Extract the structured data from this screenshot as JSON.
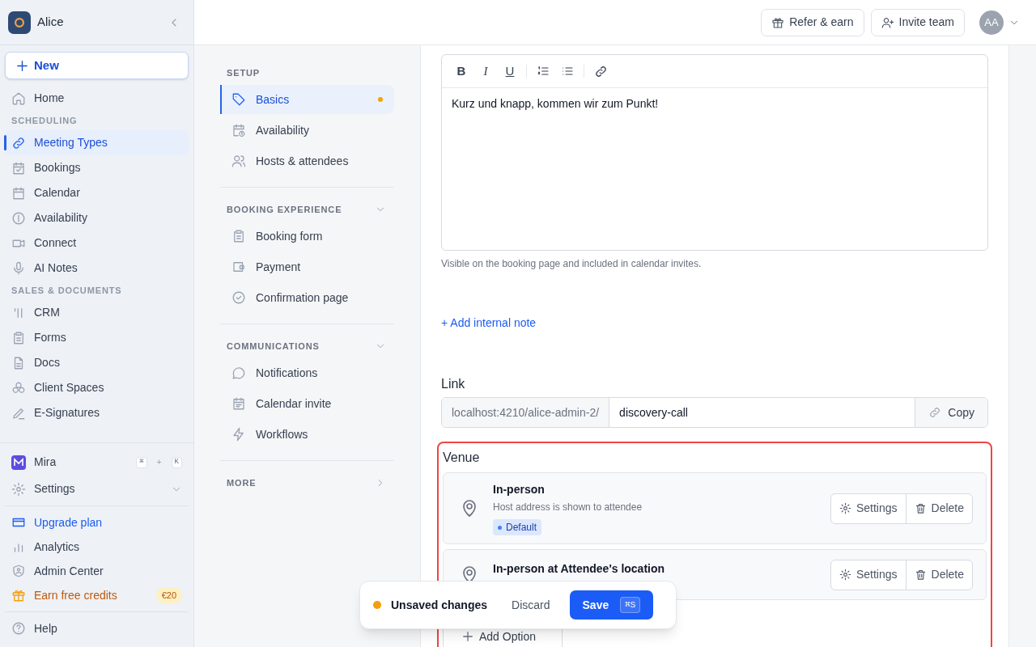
{
  "sidebar": {
    "workspace": "Alice",
    "new_button": "New",
    "nav_items": [
      {
        "kind": "item",
        "label": "Home",
        "selected": false
      },
      {
        "kind": "heading",
        "label": "SCHEDULING"
      },
      {
        "kind": "item",
        "label": "Meeting Types",
        "selected": true
      },
      {
        "kind": "item",
        "label": "Bookings",
        "selected": false
      },
      {
        "kind": "item",
        "label": "Calendar",
        "selected": false
      },
      {
        "kind": "item",
        "label": "Availability",
        "selected": false
      },
      {
        "kind": "item",
        "label": "Connect",
        "selected": false
      },
      {
        "kind": "item",
        "label": "AI Notes",
        "selected": false
      },
      {
        "kind": "heading",
        "label": "SALES & DOCUMENTS"
      },
      {
        "kind": "item",
        "label": "CRM",
        "selected": false
      },
      {
        "kind": "item",
        "label": "Forms",
        "selected": false
      },
      {
        "kind": "item",
        "label": "Docs",
        "selected": false
      },
      {
        "kind": "item",
        "label": "Client Spaces",
        "selected": false
      },
      {
        "kind": "item",
        "label": "E-Signatures",
        "selected": false
      }
    ],
    "assistant": {
      "label": "Mira",
      "shortcut": [
        "⌘",
        "+",
        "K"
      ]
    },
    "settings": {
      "label": "Settings",
      "expanded": false
    },
    "bottom_items": [
      {
        "kind": "upgrade",
        "label": "Upgrade plan"
      },
      {
        "kind": "plain",
        "label": "Analytics"
      },
      {
        "kind": "plain",
        "label": "Admin Center"
      },
      {
        "kind": "promo",
        "label": "Earn free credits",
        "badge": "€20"
      }
    ],
    "help": "Help"
  },
  "header": {
    "buttons": [
      "Refer & earn",
      "Invite team"
    ],
    "avatar": "AA"
  },
  "section_nav": [
    {
      "title": "SETUP",
      "items": [
        {
          "label": "Basics",
          "selected": true,
          "unsaved": true
        },
        {
          "label": "Availability",
          "selected": false,
          "unsaved": false
        },
        {
          "label": "Hosts & attendees",
          "selected": false,
          "unsaved": false
        }
      ]
    },
    {
      "title": "BOOKING EXPERIENCE",
      "expanded": true,
      "items": [
        {
          "label": "Booking form",
          "selected": false,
          "unsaved": false
        },
        {
          "label": "Payment",
          "selected": false,
          "unsaved": false
        },
        {
          "label": "Confirmation page",
          "selected": false,
          "unsaved": false
        }
      ]
    },
    {
      "title": "COMMUNICATIONS",
      "expanded": true,
      "items": [
        {
          "label": "Notifications",
          "selected": false,
          "unsaved": false
        },
        {
          "label": "Calendar invite",
          "selected": false,
          "unsaved": false
        },
        {
          "label": "Workflows",
          "selected": false,
          "unsaved": false
        }
      ]
    },
    {
      "title": "MORE",
      "expanded": false
    }
  ],
  "description": {
    "toolbar": [
      "B",
      "I",
      "U"
    ],
    "text": "Kurz und knapp, kommen wir zum Punkt!",
    "help": "Visible on the booking page and included in calendar invites."
  },
  "internal_note_link": "+ Add internal note",
  "link": {
    "label": "Link",
    "prefix": "localhost:4210/alice-admin-2/",
    "slug": "discovery-call",
    "copy": "Copy"
  },
  "venue": {
    "label": "Venue",
    "invalid": true,
    "options": [
      {
        "title": "In-person",
        "subtitle": "Host address is shown to attendee",
        "badge": "Default",
        "actions": [
          "Settings",
          "Delete"
        ]
      },
      {
        "title": "In-person at Attendee's location",
        "actions": [
          "Settings",
          "Delete"
        ]
      }
    ],
    "add_option": "Add Option"
  },
  "toast": {
    "message": "Unsaved changes",
    "discard": "Discard",
    "save": "Save",
    "shortcut": "⌘S"
  }
}
